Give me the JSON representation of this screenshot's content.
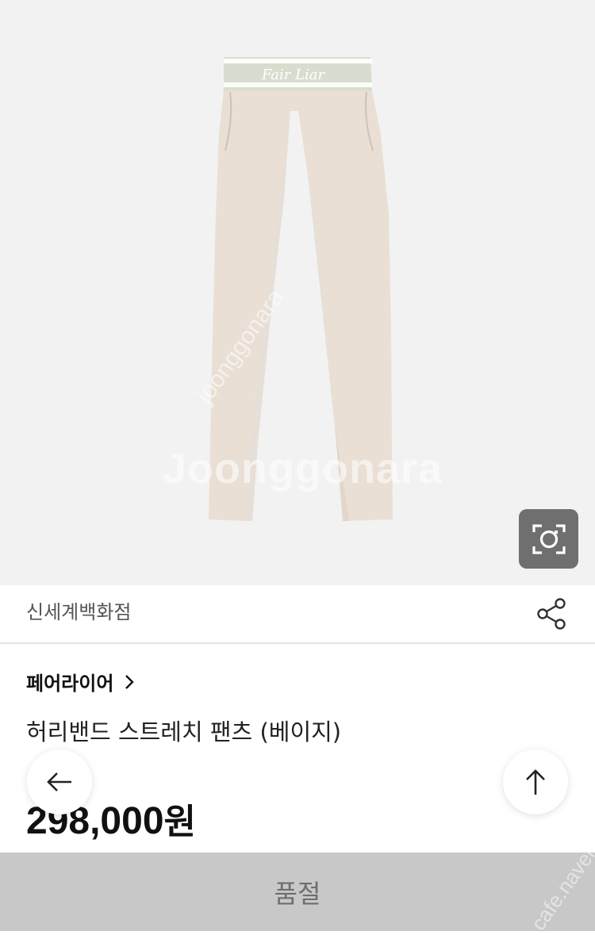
{
  "hero": {
    "watermark_main": "Joonggonara",
    "watermark_diagonal": "joonggonara",
    "waistband_logo": "Fair Liar",
    "background_color": "#f2f2f2",
    "pants_color": "#e9dfd4",
    "waistband_color": "#d9ddcf"
  },
  "store": {
    "name": "신세계백화점"
  },
  "product": {
    "brand": "페어라이어",
    "title": "허리밴드 스트레치 팬츠 (베이지)",
    "price": "298,000",
    "price_unit": "원"
  },
  "bottom_bar": {
    "label": "품절",
    "watermark": "cafe.naver"
  },
  "icons": {
    "lens": "camera-search-icon",
    "share": "share-icon",
    "brand_arrow": "chevron-right-icon",
    "back": "arrow-left-icon",
    "top": "arrow-up-icon"
  }
}
